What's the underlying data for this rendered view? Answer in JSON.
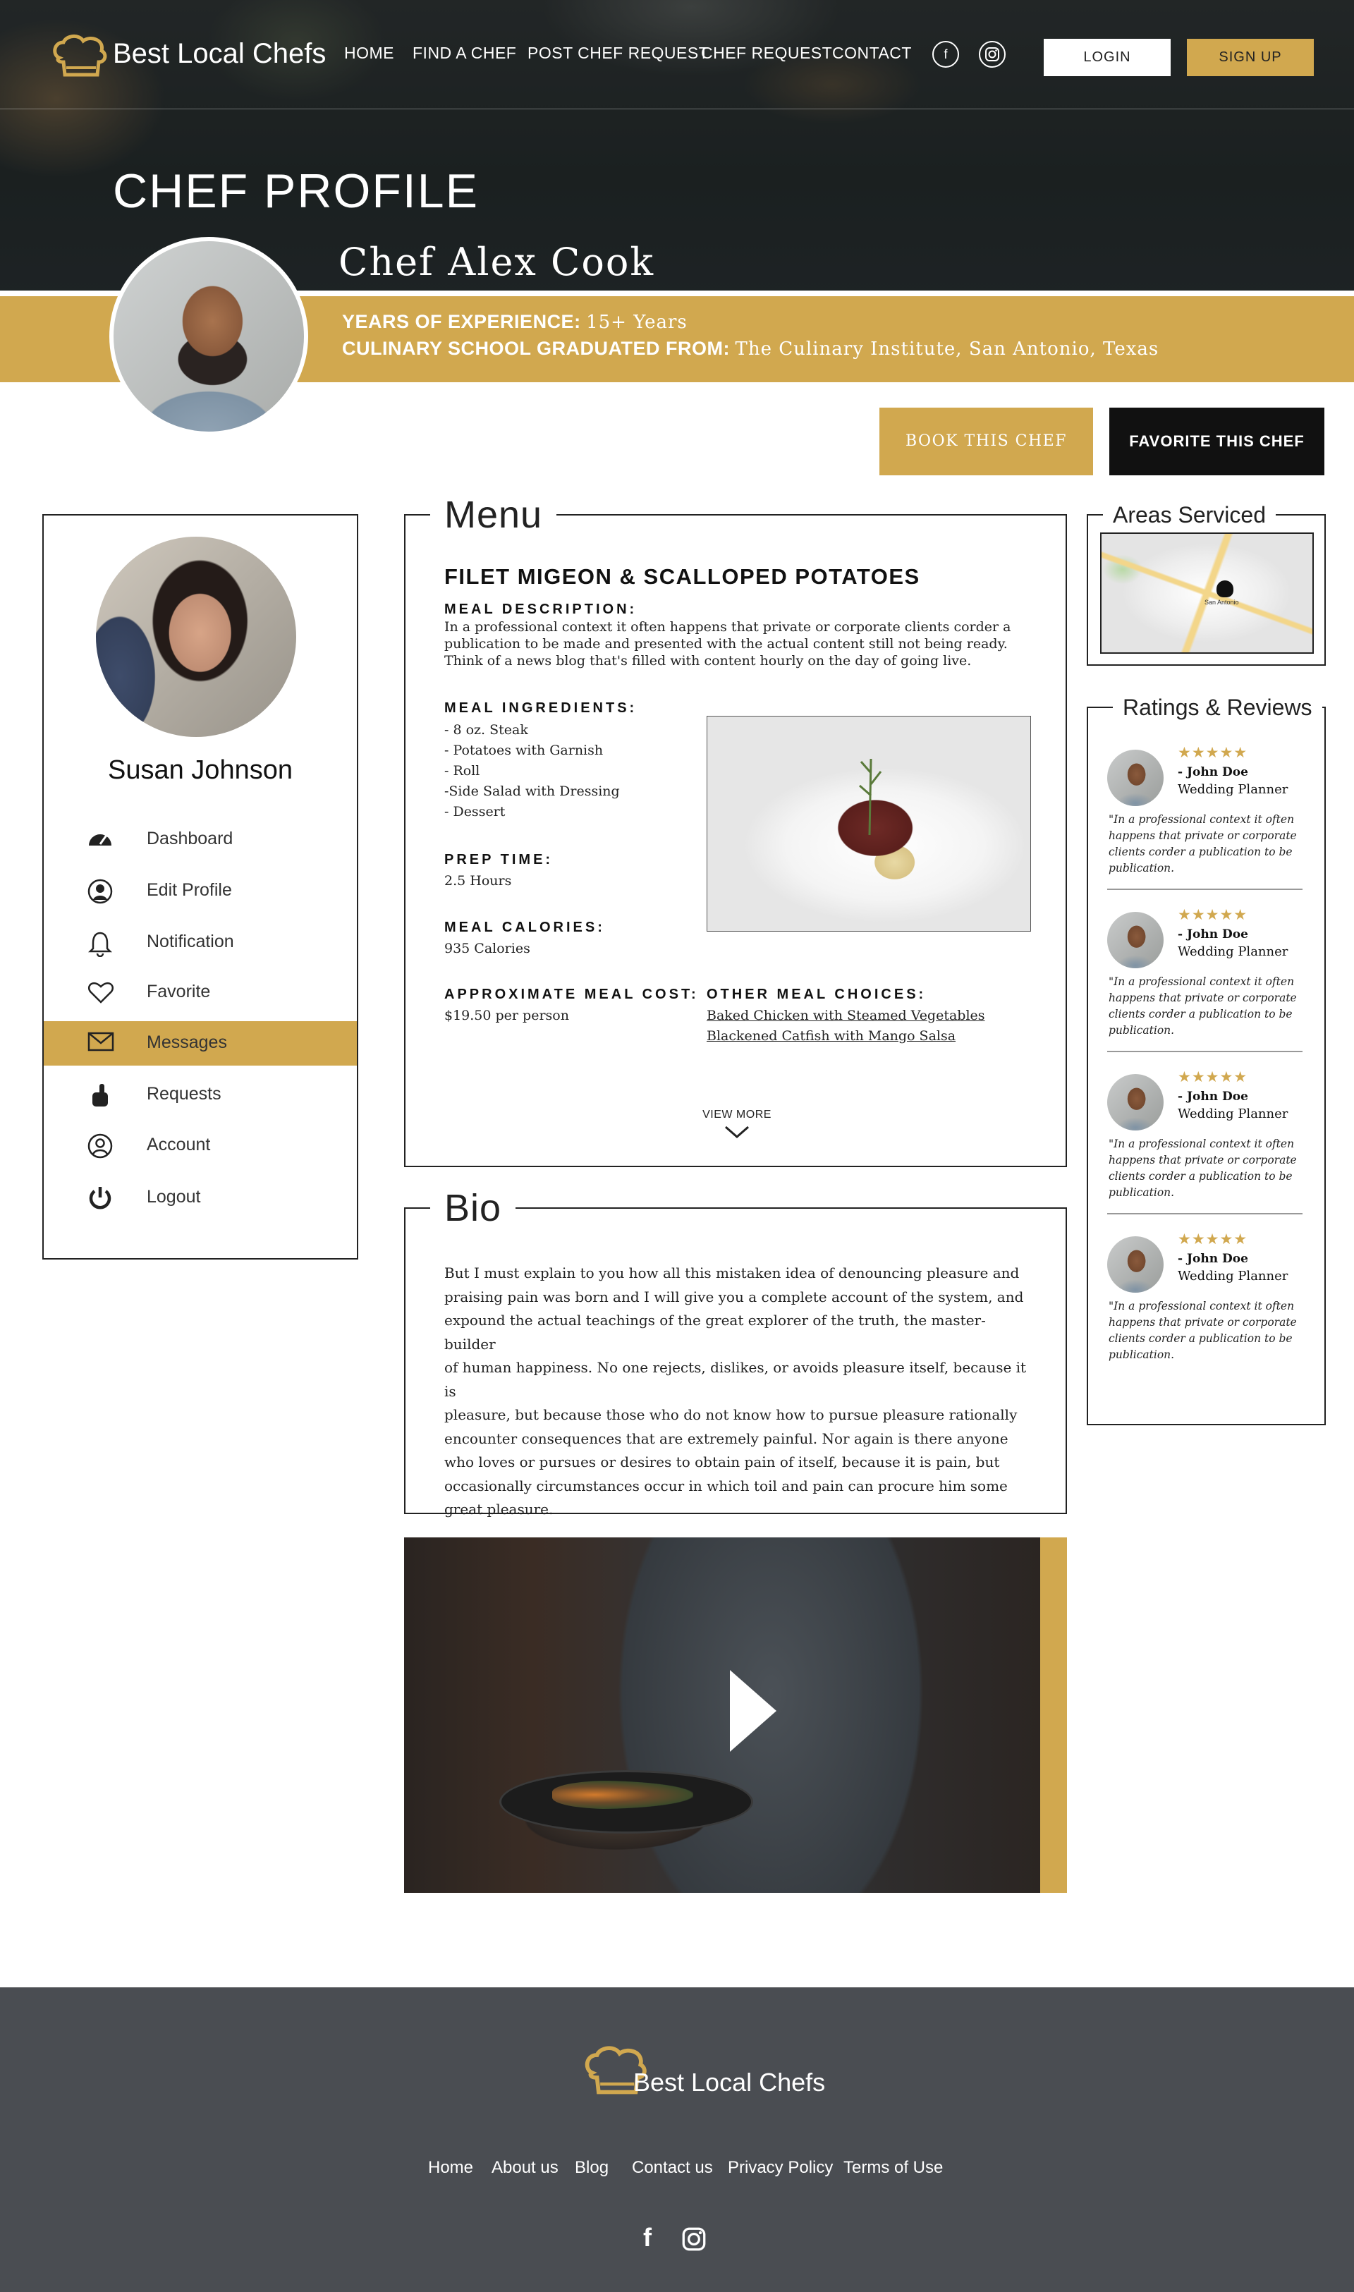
{
  "brand": {
    "name": "Best Local Chefs",
    "logo_icon": "chef-hat-icon",
    "accent": "#d1a84f"
  },
  "nav": {
    "items": [
      "HOME",
      "FIND A CHEF",
      "POST CHEF REQUEST",
      "CHEF REQUEST",
      "CONTACT"
    ],
    "login": "LOGIN",
    "signup": "SIGN UP",
    "social": [
      "facebook-icon",
      "instagram-icon"
    ]
  },
  "page": {
    "title": "CHEF PROFILE"
  },
  "chef": {
    "name": "Chef Alex Cook",
    "experience_label": "YEARS OF EXPERIENCE:",
    "experience_value": "15+ Years",
    "school_label": "CULINARY SCHOOL GRADUATED FROM:",
    "school_value": "The Culinary Institute, San Antonio, Texas"
  },
  "actions": {
    "book": "BOOK THIS CHEF",
    "favorite": "FAVORITE THIS CHEF"
  },
  "sidebar": {
    "user_name": "Susan Johnson",
    "items": [
      {
        "label": "Dashboard",
        "icon": "dashboard-gauge-icon"
      },
      {
        "label": "Edit Profile",
        "icon": "edit-profile-icon"
      },
      {
        "label": "Notification",
        "icon": "bell-icon"
      },
      {
        "label": "Favorite",
        "icon": "heart-icon"
      },
      {
        "label": "Messages",
        "icon": "envelope-icon"
      },
      {
        "label": "Requests",
        "icon": "hand-icon"
      },
      {
        "label": "Account",
        "icon": "user-circle-icon"
      },
      {
        "label": "Logout",
        "icon": "power-icon"
      }
    ],
    "active_index": 4
  },
  "menu": {
    "title": "Menu",
    "dish_title": "FILET MIGEON & SCALLOPED POTATOES",
    "description_label": "MEAL DESCRIPTION:",
    "description": [
      "In a professional context it often happens that private or corporate clients corder a",
      "publication to be made and presented with the actual content still not being ready.",
      "Think of a news blog that's filled with content hourly on the day of going live."
    ],
    "ingredients_label": "MEAL INGREDIENTS:",
    "ingredients": [
      "- 8 oz. Steak",
      "- Potatoes with Garnish",
      "- Roll",
      "-Side Salad with Dressing",
      "- Dessert"
    ],
    "prep_label": "PREP TIME:",
    "prep_value": "2.5 Hours",
    "calories_label": "MEAL CALORIES:",
    "calories_value": "935 Calories",
    "cost_label": "APPROXIMATE MEAL COST:",
    "cost_value": "$19.50 per person",
    "other_label": "OTHER MEAL CHOICES:",
    "other_choices": [
      "Baked Chicken with Steamed Vegetables",
      "Blackened Catfish with Mango Salsa"
    ],
    "view_more": "VIEW MORE"
  },
  "bio": {
    "title": "Bio",
    "lines": [
      "But I must explain to you how all this mistaken idea of denouncing pleasure and",
      "praising pain was born and I will give you a complete account of the system, and",
      "expound the actual teachings of the great explorer of the truth, the master-builder",
      "of human happiness. No one rejects, dislikes, or avoids pleasure itself, because it is",
      "pleasure, but because those who do not know how to pursue pleasure rationally",
      "encounter consequences that are extremely painful. Nor again is there anyone",
      "who loves or pursues or desires to obtain pain of itself, because it is pain, but",
      "occasionally circumstances occur in which toil and pain can procure him some",
      "great pleasure."
    ]
  },
  "areas": {
    "title": "Areas Serviced",
    "map_label": "San Antonio"
  },
  "reviews": {
    "title": "Ratings & Reviews",
    "items": [
      {
        "stars": "★★★★★",
        "name": "- John Doe",
        "role": "Wedding Planner",
        "text": [
          "\"In a professional context it often",
          "happens that private or corporate",
          "clients corder a publication to be",
          "publication."
        ]
      },
      {
        "stars": "★★★★★",
        "name": "- John Doe",
        "role": "Wedding Planner",
        "text": [
          "\"In a professional context it often",
          "happens that private or corporate",
          "clients corder a publication to be",
          "publication."
        ]
      },
      {
        "stars": "★★★★★",
        "name": "- John Doe",
        "role": "Wedding Planner",
        "text": [
          "\"In a professional context it often",
          "happens that private or corporate",
          "clients corder a publication to be",
          "publication."
        ]
      },
      {
        "stars": "★★★★★",
        "name": "- John Doe",
        "role": "Wedding Planner",
        "text": [
          "\"In a professional context it often",
          "happens that private or corporate",
          "clients corder a publication to be",
          "publication."
        ]
      }
    ]
  },
  "footer": {
    "brand": "Best Local Chefs",
    "links": [
      "Home",
      "About us",
      "Blog",
      "Contact us",
      "Privacy Policy",
      "Terms of Use"
    ]
  }
}
